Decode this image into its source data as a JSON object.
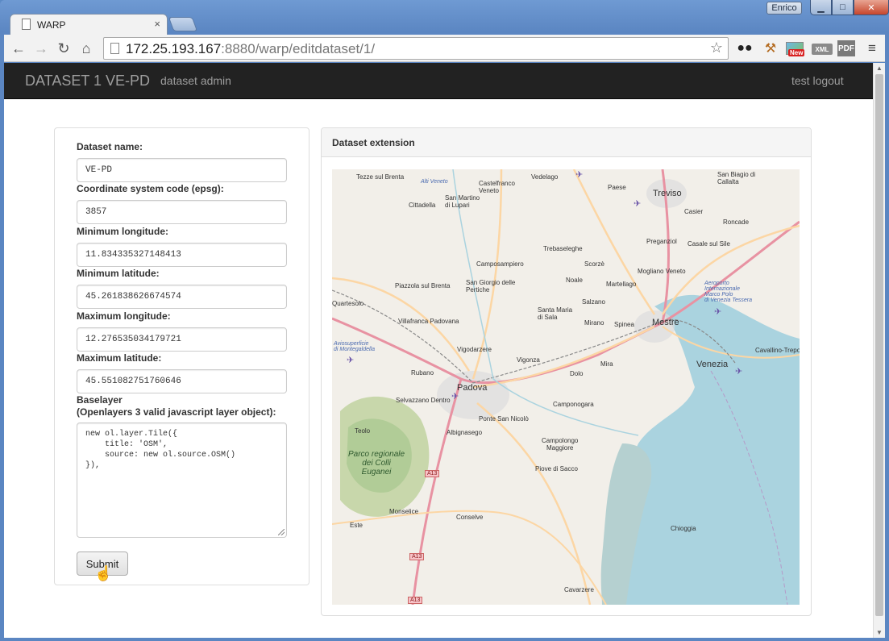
{
  "browser": {
    "user_name": "Enrico",
    "tab_title": "WARP",
    "url_host": "172.25.193.167",
    "url_rest": ":8880/warp/editdataset/1/",
    "new_badge": "New",
    "xml_label": "XML",
    "pdf_label": "PDF"
  },
  "navbar": {
    "brand": "DATASET 1 VE-PD",
    "links": [
      "dataset admin",
      "test logout"
    ]
  },
  "form": {
    "fields": [
      {
        "label": "Dataset name:",
        "value": "VE-PD"
      },
      {
        "label": "Coordinate system code (epsg):",
        "value": "3857"
      },
      {
        "label": "Minimum longitude:",
        "value": "11.834335327148413"
      },
      {
        "label": "Minimum latitude:",
        "value": "45.261838626674574"
      },
      {
        "label": "Maximum longitude:",
        "value": "12.276535034179721"
      },
      {
        "label": "Maximum latitude:",
        "value": "45.551082751760646"
      }
    ],
    "baselayer_label_1": "Baselayer",
    "baselayer_label_2": "(Openlayers 3 valid javascript layer object):",
    "baselayer_value": "new ol.layer.Tile({\n    title: 'OSM',\n    source: new ol.source.OSM()\n}),",
    "submit_label": "Submit"
  },
  "map_panel": {
    "title": "Dataset extension",
    "places": {
      "tezze": "Tezze sul Brenta",
      "vedelago": "Vedelago",
      "castelfranco": "Castelfranco\nVeneto",
      "paese": "Paese",
      "treviso": "Treviso",
      "sanbiagio": "San Biagio di\nCallalta",
      "cittadella": "Cittadella",
      "sanmartino": "San Martino\ndi Lupari",
      "altoveneto": "Alti Veneto",
      "casier": "Casier",
      "roncade": "Roncade",
      "trebaseleghe": "Trebaseleghe",
      "preganziol": "Preganziol",
      "casale": "Casale sul Sile",
      "camposampiero": "Camposampiero",
      "scorze": "Scorzè",
      "mogliano": "Mogliano Veneto",
      "piazzola": "Piazzola sul Brenta",
      "sangiorgio": "San Giorgio delle\nPertiche",
      "noale": "Noale",
      "martellago": "Martellago",
      "aeroporto": "Aeroporto\nInternazionale\nMarco Polo\ndi Venezia Tessera",
      "quartesolo": "Quartesolo",
      "santamaria": "Santa Maria\ndi Sala",
      "salzano": "Salzano",
      "villafranca": "Villafranca Padovana",
      "mirano": "Mirano",
      "spinea": "Spinea",
      "mestre": "Mestre",
      "aviosup": "Aviosuperficie\ndi Montegaldella",
      "vigodarzere": "Vigodarzere",
      "cavallino": "Cavallino-Trepo",
      "vigonza": "Vigonza",
      "rubano": "Rubano",
      "dolo": "Dolo",
      "mira": "Mira",
      "venezia": "Venezia",
      "padova": "Padova",
      "selvazzano": "Selvazzano Dentro",
      "camponogara": "Camponogara",
      "teolo": "Teolo",
      "pontesannicolo": "Ponte San Nicolò",
      "albignasego": "Albignasego",
      "parco": "Parco regionale\ndei Colli\nEuganei",
      "campolongo": "Campolongo\nMaggiore",
      "piove": "Piove di Sacco",
      "monselice": "Monselice",
      "conselve": "Conselve",
      "este": "Este",
      "chioggia": "Chioggia",
      "cavarzere": "Cavarzere",
      "a13": "A13"
    }
  }
}
